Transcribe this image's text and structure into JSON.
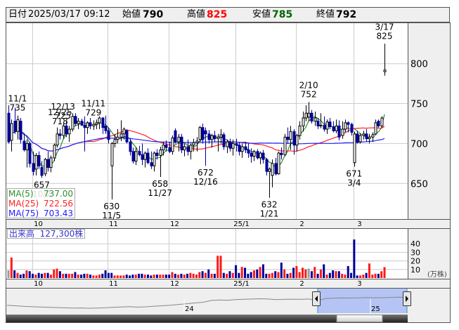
{
  "header": {
    "date_label": "日付",
    "datetime": "2025/03/17 09:12",
    "open_label": "始値",
    "open": "790",
    "high_label": "高値",
    "high": "825",
    "low_label": "安値",
    "low": "785",
    "close_label": "終値",
    "close": "792"
  },
  "colors": {
    "up_volume": "#ff1a1a",
    "down_volume": "#000099",
    "flat_volume": "#999999",
    "down_candle": "#000099",
    "up_candle": "#ffffff",
    "ma5": "#2e8b2e",
    "ma25": "#ff2020",
    "ma75": "#2020ff",
    "high_text": "#ff0000",
    "low_text": "#006400",
    "nav_selection": "#b4c4f4"
  },
  "ma_legend": [
    {
      "label": "MA(5)",
      "value": "737.00",
      "period": 5
    },
    {
      "label": "MA(25)",
      "value": "722.56",
      "period": 25
    },
    {
      "label": "MA(75)",
      "value": "703.43",
      "period": 75
    }
  ],
  "volume_legend": {
    "label": "出来高",
    "value": "127,300株"
  },
  "chart_data": {
    "type": "candlestick",
    "price_axis": {
      "ticks": [
        650,
        700,
        750,
        800
      ],
      "range": [
        610,
        845
      ],
      "grid": true
    },
    "volume_axis": {
      "ticks": [
        10,
        20,
        30,
        40
      ],
      "unit": "(万株)",
      "grid": true
    },
    "month_starts": [
      {
        "label": "10",
        "index": 8
      },
      {
        "label": "11",
        "index": 33
      },
      {
        "label": "12",
        "index": 53
      },
      {
        "label": "25/1",
        "index": 75
      },
      {
        "label": "2",
        "index": 95
      },
      {
        "label": "3",
        "index": 114
      }
    ],
    "ohlc": [
      [
        738,
        748,
        700,
        702
      ],
      [
        704,
        730,
        690,
        725
      ],
      [
        728,
        745,
        712,
        715
      ],
      [
        715,
        735,
        705,
        730
      ],
      [
        728,
        732,
        700,
        705
      ],
      [
        703,
        712,
        690,
        692
      ],
      [
        692,
        705,
        670,
        700
      ],
      [
        700,
        702,
        670,
        675
      ],
      [
        675,
        690,
        660,
        665
      ],
      [
        668,
        688,
        660,
        685
      ],
      [
        685,
        690,
        668,
        672
      ],
      [
        670,
        678,
        657,
        660
      ],
      [
        662,
        682,
        659,
        680
      ],
      [
        680,
        690,
        665,
        670
      ],
      [
        670,
        685,
        664,
        682
      ],
      [
        682,
        700,
        678,
        698
      ],
      [
        698,
        720,
        695,
        712
      ],
      [
        712,
        718,
        705,
        710
      ],
      [
        710,
        725,
        706,
        722
      ],
      [
        722,
        728,
        708,
        712
      ],
      [
        712,
        722,
        702,
        718
      ],
      [
        718,
        738,
        715,
        734
      ],
      [
        734,
        738,
        722,
        725
      ],
      [
        725,
        732,
        718,
        728
      ],
      [
        728,
        731,
        722,
        723
      ],
      [
        723,
        734,
        690,
        720
      ],
      [
        720,
        728,
        712,
        726
      ],
      [
        726,
        732,
        718,
        722
      ],
      [
        722,
        729,
        717,
        724
      ],
      [
        724,
        730,
        718,
        726
      ],
      [
        726,
        734,
        718,
        732
      ],
      [
        732,
        733,
        712,
        720
      ],
      [
        722,
        735,
        712,
        716
      ],
      [
        716,
        720,
        700,
        705
      ],
      [
        672,
        702,
        630,
        700
      ],
      [
        700,
        712,
        695,
        705
      ],
      [
        705,
        718,
        700,
        708
      ],
      [
        708,
        729,
        703,
        712
      ],
      [
        712,
        720,
        705,
        718
      ],
      [
        716,
        718,
        700,
        702
      ],
      [
        702,
        706,
        685,
        690
      ],
      [
        690,
        695,
        675,
        678
      ],
      [
        678,
        695,
        673,
        690
      ],
      [
        690,
        697,
        684,
        686
      ],
      [
        686,
        700,
        673,
        680
      ],
      [
        680,
        690,
        670,
        688
      ],
      [
        688,
        694,
        674,
        676
      ],
      [
        676,
        690,
        668,
        672
      ],
      [
        672,
        690,
        665,
        688
      ],
      [
        688,
        693,
        680,
        685
      ],
      [
        685,
        696,
        658,
        692
      ],
      [
        692,
        702,
        685,
        698
      ],
      [
        698,
        704,
        690,
        695
      ],
      [
        695,
        702,
        688,
        690
      ],
      [
        690,
        710,
        686,
        707
      ],
      [
        716,
        719,
        700,
        702
      ],
      [
        702,
        712,
        690,
        708
      ],
      [
        708,
        712,
        688,
        692
      ],
      [
        692,
        700,
        684,
        696
      ],
      [
        696,
        705,
        685,
        690
      ],
      [
        690,
        700,
        680,
        698
      ],
      [
        698,
        706,
        690,
        701
      ],
      [
        701,
        708,
        690,
        703
      ],
      [
        705,
        722,
        702,
        720
      ],
      [
        720,
        725,
        700,
        705
      ],
      [
        716,
        720,
        672,
        712
      ],
      [
        712,
        717,
        700,
        705
      ],
      [
        705,
        712,
        695,
        710
      ],
      [
        710,
        716,
        702,
        706
      ],
      [
        706,
        712,
        690,
        708
      ],
      [
        708,
        718,
        700,
        711
      ],
      [
        711,
        714,
        692,
        696
      ],
      [
        696,
        705,
        688,
        702
      ],
      [
        702,
        706,
        690,
        694
      ],
      [
        694,
        705,
        685,
        700
      ],
      [
        700,
        706,
        690,
        698
      ],
      [
        698,
        702,
        685,
        690
      ],
      [
        690,
        700,
        682,
        696
      ],
      [
        696,
        702,
        688,
        692
      ],
      [
        692,
        700,
        682,
        688
      ],
      [
        688,
        694,
        676,
        684
      ],
      [
        684,
        692,
        678,
        690
      ],
      [
        690,
        693,
        680,
        682
      ],
      [
        682,
        690,
        674,
        688
      ],
      [
        688,
        692,
        675,
        680
      ],
      [
        680,
        682,
        660,
        665
      ],
      [
        665,
        670,
        632,
        668
      ],
      [
        660,
        680,
        645,
        675
      ],
      [
        675,
        682,
        660,
        662
      ],
      [
        662,
        690,
        661,
        688
      ],
      [
        688,
        695,
        680,
        686
      ],
      [
        686,
        712,
        684,
        708
      ],
      [
        708,
        720,
        700,
        705
      ],
      [
        705,
        722,
        692,
        715
      ],
      [
        715,
        718,
        686,
        698
      ],
      [
        698,
        712,
        690,
        710
      ],
      [
        710,
        728,
        705,
        722
      ],
      [
        722,
        740,
        715,
        732
      ],
      [
        732,
        748,
        728,
        738
      ],
      [
        733,
        752,
        728,
        738
      ],
      [
        738,
        742,
        725,
        728
      ],
      [
        728,
        740,
        722,
        732
      ],
      [
        728,
        732,
        718,
        722
      ],
      [
        722,
        738,
        719,
        723
      ],
      [
        723,
        734,
        715,
        718
      ],
      [
        718,
        730,
        712,
        727
      ],
      [
        727,
        732,
        718,
        721
      ],
      [
        721,
        728,
        714,
        716
      ],
      [
        716,
        730,
        713,
        722
      ],
      [
        722,
        729,
        704,
        708
      ],
      [
        710,
        728,
        706,
        718
      ],
      [
        718,
        730,
        714,
        726
      ],
      [
        726,
        728,
        714,
        724
      ],
      [
        724,
        726,
        710,
        714
      ],
      [
        676,
        715,
        671,
        712
      ],
      [
        712,
        716,
        700,
        702
      ],
      [
        702,
        713,
        700,
        710
      ],
      [
        710,
        716,
        705,
        712
      ],
      [
        712,
        718,
        702,
        706
      ],
      [
        706,
        712,
        700,
        708
      ],
      [
        708,
        714,
        702,
        711
      ],
      [
        712,
        730,
        710,
        726
      ],
      [
        728,
        730,
        720,
        722
      ],
      [
        722,
        734,
        720,
        732
      ],
      [
        790,
        825,
        785,
        792
      ]
    ],
    "volume": [
      9,
      24,
      9,
      6,
      4,
      5,
      9,
      8,
      5,
      4,
      6,
      5,
      6,
      6,
      4,
      10,
      11,
      8,
      5,
      5,
      5,
      5,
      7,
      4,
      4,
      5,
      5,
      4,
      3,
      3,
      4,
      5,
      9,
      6,
      6,
      3,
      3,
      3,
      3,
      4,
      3,
      4,
      4,
      5,
      5,
      4,
      4,
      3,
      4,
      4,
      4,
      4,
      4,
      4,
      7,
      5,
      4,
      5,
      4,
      5,
      6,
      5,
      4,
      7,
      8,
      6,
      10,
      5,
      5,
      26,
      26,
      6,
      5,
      8,
      6,
      15,
      6,
      13,
      12,
      5,
      7,
      9,
      10,
      13,
      16,
      5,
      5,
      6,
      8,
      7,
      18,
      10,
      5,
      6,
      12,
      14,
      7,
      12,
      10,
      11,
      8,
      13,
      5,
      10,
      16,
      4,
      6,
      9,
      8,
      8,
      5,
      4,
      14,
      6,
      45,
      3,
      3,
      4,
      6,
      17,
      4,
      5,
      5,
      8,
      12.73
    ],
    "annotations": [
      {
        "date": "3/17",
        "price": 825,
        "kind": "high"
      },
      {
        "date": "2/10",
        "price": 752,
        "kind": "high"
      },
      {
        "date": "11/1",
        "price": 735,
        "kind": "high"
      },
      {
        "date": "11/11",
        "price": 729,
        "kind": "high"
      },
      {
        "date": "12/13",
        "price": 725,
        "kind": "high"
      },
      {
        "date": "12/25",
        "price": 718,
        "kind": "high"
      },
      {
        "date": "10/2",
        "price": 657,
        "kind": "low"
      },
      {
        "date": "11/5",
        "price": 630,
        "kind": "low"
      },
      {
        "date": "11/27",
        "price": 658,
        "kind": "low"
      },
      {
        "date": "12/16",
        "price": 672,
        "kind": "low"
      },
      {
        "date": "1/21",
        "price": 632,
        "kind": "low"
      },
      {
        "date": "3/4",
        "price": 671,
        "kind": "low"
      }
    ]
  },
  "navigator": {
    "year_labels": [
      "24",
      "25"
    ],
    "series": [
      640,
      636,
      632,
      630,
      628,
      626,
      624,
      622,
      620,
      621,
      619,
      620,
      622,
      626,
      628,
      630,
      627,
      629,
      633,
      636,
      640,
      645,
      650,
      655,
      660,
      672,
      676,
      674,
      678,
      680,
      682,
      684,
      682,
      678,
      680,
      681,
      680,
      682,
      670,
      685,
      688,
      690,
      689,
      690,
      692,
      690,
      691,
      693,
      695,
      692
    ]
  }
}
